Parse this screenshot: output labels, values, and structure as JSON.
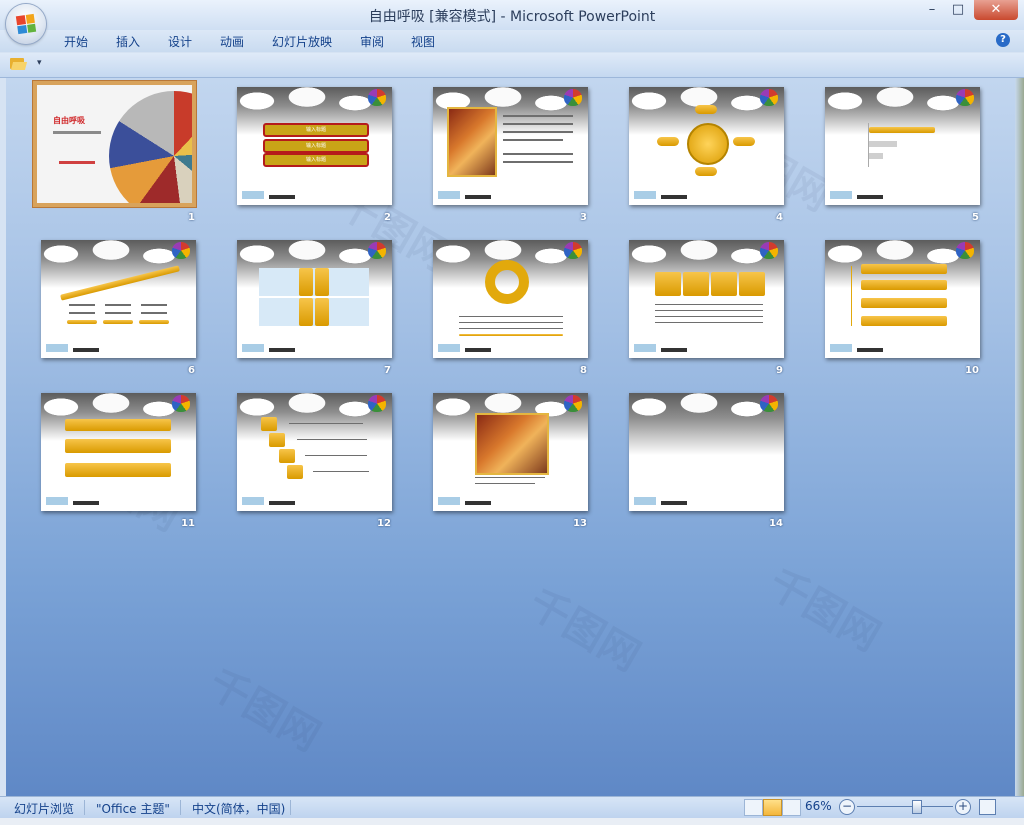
{
  "window": {
    "title": "自由呼吸 [兼容模式] - Microsoft PowerPoint",
    "controls": {
      "minimize": "–",
      "maximize": "□",
      "close": "✕"
    }
  },
  "ribbon": {
    "tabs": [
      "开始",
      "插入",
      "设计",
      "动画",
      "幻灯片放映",
      "审阅",
      "视图"
    ],
    "help": "?"
  },
  "qat": {
    "dropdown": "▾"
  },
  "slides": [
    {
      "num": "1",
      "title": "自由呼吸",
      "selected": true
    },
    {
      "num": "2",
      "buttons": [
        "输入标题",
        "输入标题",
        "输入标题"
      ]
    },
    {
      "num": "3"
    },
    {
      "num": "4"
    },
    {
      "num": "5"
    },
    {
      "num": "6"
    },
    {
      "num": "7"
    },
    {
      "num": "8"
    },
    {
      "num": "9"
    },
    {
      "num": "10"
    },
    {
      "num": "11"
    },
    {
      "num": "12"
    },
    {
      "num": "13"
    },
    {
      "num": "14"
    }
  ],
  "status": {
    "view": "幻灯片浏览",
    "theme": "\"Office 主题\"",
    "language": "中文(简体，中国)",
    "zoom": "66%",
    "zoom_level": 0.66
  },
  "watermark": "千图网"
}
